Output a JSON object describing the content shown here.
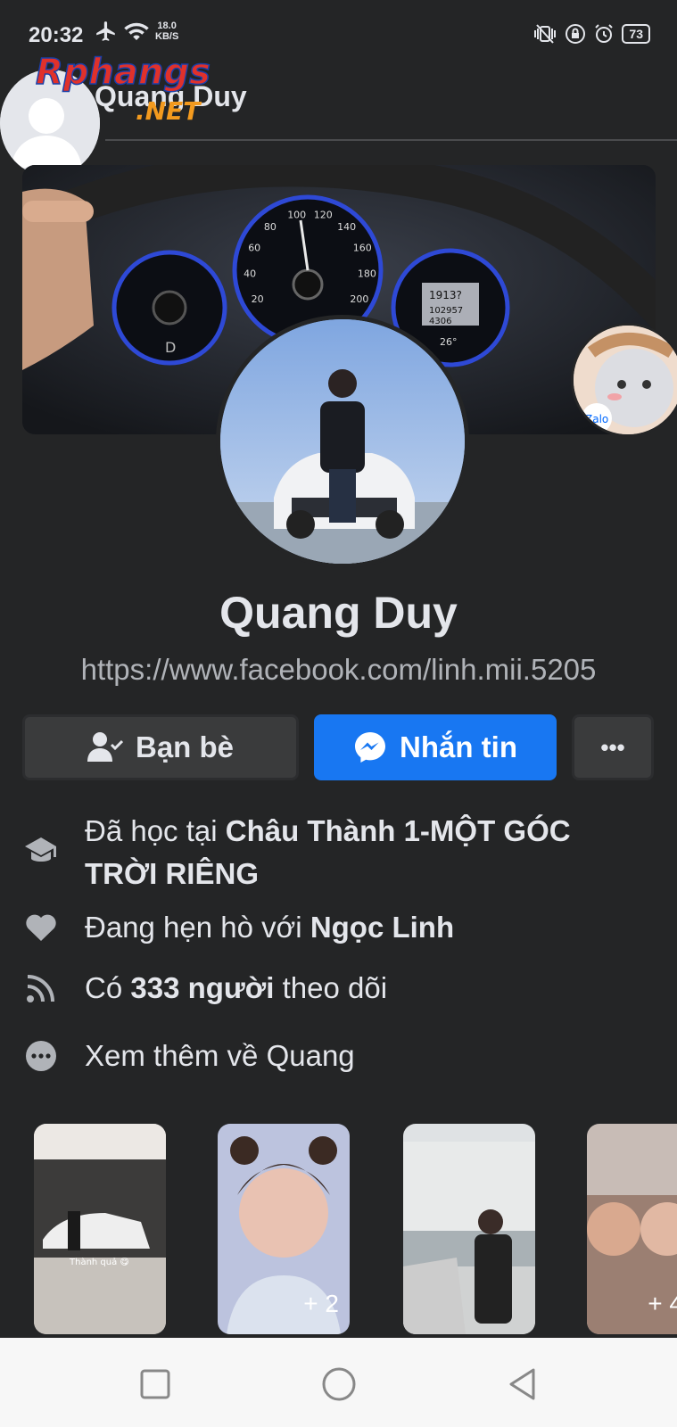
{
  "status_bar": {
    "time": "20:32",
    "net_speed_value": "18.0",
    "net_speed_unit": "KB/S",
    "battery": "73"
  },
  "watermark": {
    "brand": "Rphangs",
    "domain": ".NET"
  },
  "header": {
    "title": "Quang Duy"
  },
  "profile": {
    "name": "Quang Duy",
    "url": "https://www.facebook.com/linh.mii.5205"
  },
  "cover": {
    "speedometer_ticks": [
      "20",
      "40",
      "60",
      "80",
      "100",
      "120",
      "140",
      "160",
      "180",
      "200"
    ],
    "odometer": "1913?",
    "trip": "102957",
    "trip2": "4306",
    "temp": "26°",
    "gear": "D"
  },
  "zalo_badge": {
    "label": "Zalo"
  },
  "actions": {
    "friends_label": "Bạn bè",
    "message_label": "Nhắn tin",
    "more_label": "•••"
  },
  "info": {
    "education_prefix": "Đã học tại ",
    "education_school_line1": "Châu Thành 1-MỘT GÓC",
    "education_school_line2": "TRỜI RIÊNG",
    "relationship_prefix": "Đang hẹn hò với ",
    "relationship_partner": "Ngọc Linh",
    "followers_prefix": "Có ",
    "followers_count": "333 người",
    "followers_suffix": " theo dõi",
    "see_more": "Xem thêm về Quang"
  },
  "photos": [
    {
      "caption": "Thành quả 😋",
      "count": ""
    },
    {
      "caption": "",
      "count": "+ 2"
    },
    {
      "caption": "",
      "count": ""
    },
    {
      "caption": "",
      "count": "+ 4"
    }
  ],
  "colors": {
    "background": "#242526",
    "accent": "#1877f2",
    "button_secondary": "#3a3b3c",
    "text_primary": "#e4e6eb",
    "text_secondary": "#b0b3b8"
  }
}
